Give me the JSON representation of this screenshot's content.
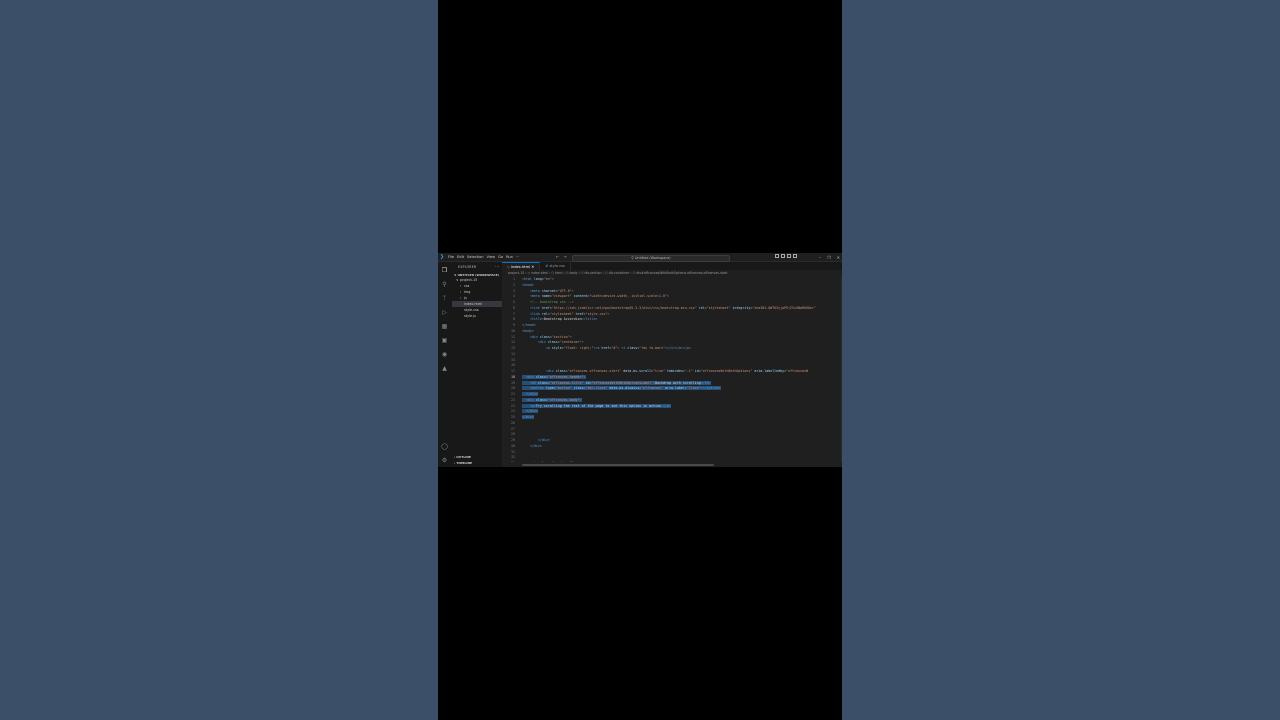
{
  "titlebar": {
    "menu": [
      "File",
      "Edit",
      "Selection",
      "View",
      "Go",
      "Run",
      "···"
    ],
    "search": "Untitled (Workspace)"
  },
  "sidebar": {
    "title": "EXPLORER",
    "workspace": "UNTITLED (WORKSPACE)",
    "tree": [
      {
        "label": "project-15",
        "indent": 1,
        "chevron": "∨"
      },
      {
        "label": "css",
        "indent": 2,
        "chevron": "›"
      },
      {
        "label": "img",
        "indent": 2,
        "chevron": "›"
      },
      {
        "label": "js",
        "indent": 2,
        "chevron": "›"
      },
      {
        "label": "index.html",
        "indent": 2,
        "chevron": "",
        "selected": true
      },
      {
        "label": "style.css",
        "indent": 2,
        "chevron": ""
      },
      {
        "label": "style.js",
        "indent": 2,
        "chevron": ""
      }
    ],
    "outline": "OUTLINE",
    "timeline": "TIMELINE"
  },
  "editor": {
    "tabs": [
      {
        "label": "index.html",
        "active": true
      },
      {
        "label": "style.css",
        "active": false
      }
    ],
    "breadcrumb": "project-15 › ◇ index.html › ⬡ html › ⬡ body › ⬡ div.section › ⬡ div.container › ⬡ div#offcanvasWithBothOptions.offcanvas.offcanvas-start",
    "lines": [
      {
        "n": "1",
        "parts": [
          [
            "tag",
            "<html "
          ],
          [
            "attr",
            "lang="
          ],
          [
            "str",
            "\"en\""
          ],
          [
            "tag",
            ">"
          ]
        ]
      },
      {
        "n": "2",
        "parts": [
          [
            "tag",
            "<head>"
          ]
        ]
      },
      {
        "n": "3",
        "parts": [
          [
            "plain",
            "    "
          ],
          [
            "tag",
            "<meta "
          ],
          [
            "attr",
            "charset="
          ],
          [
            "str",
            "\"UTF-8\""
          ],
          [
            "tag",
            ">"
          ]
        ]
      },
      {
        "n": "4",
        "parts": [
          [
            "plain",
            "    "
          ],
          [
            "tag",
            "<meta "
          ],
          [
            "attr",
            "name="
          ],
          [
            "str",
            "\"viewport\" "
          ],
          [
            "attr",
            "content="
          ],
          [
            "str",
            "\"width=device-width, initial-scale=1.0\""
          ],
          [
            "tag",
            ">"
          ]
        ]
      },
      {
        "n": "5",
        "parts": [
          [
            "plain",
            "    "
          ],
          [
            "com",
            "<!-- bootstrap css -->"
          ]
        ]
      },
      {
        "n": "6",
        "parts": [
          [
            "plain",
            "    "
          ],
          [
            "tag",
            "<link "
          ],
          [
            "attr",
            "href="
          ],
          [
            "str",
            "\"https://cdn.jsdelivr.net/npm/bootstrap@5.3.3/dist/css/bootstrap.min.css\" "
          ],
          [
            "attr",
            "rel="
          ],
          [
            "str",
            "\"stylesheet\" "
          ],
          [
            "attr",
            "integrity="
          ],
          [
            "str",
            "\"sha384-QWTKZyjpPEjISv5WaRU9Oer\""
          ]
        ]
      },
      {
        "n": "7",
        "parts": [
          [
            "plain",
            "    "
          ],
          [
            "tag",
            "<link "
          ],
          [
            "attr",
            "rel="
          ],
          [
            "str",
            "\"stylesheet\" "
          ],
          [
            "attr",
            "href="
          ],
          [
            "str",
            "\"style.css\""
          ],
          [
            "tag",
            ">"
          ]
        ]
      },
      {
        "n": "8",
        "parts": [
          [
            "plain",
            "    "
          ],
          [
            "tag",
            "<title>"
          ],
          [
            "plain",
            "Bootstrap Accordion"
          ],
          [
            "tag",
            "</title>"
          ]
        ]
      },
      {
        "n": "9",
        "parts": [
          [
            "tag",
            "</head>"
          ]
        ]
      },
      {
        "n": "10",
        "parts": [
          [
            "tag",
            "<body>"
          ]
        ]
      },
      {
        "n": "11",
        "parts": [
          [
            "plain",
            "    "
          ],
          [
            "tag",
            "<div "
          ],
          [
            "attr",
            "class="
          ],
          [
            "str",
            "\"section\""
          ],
          [
            "tag",
            ">"
          ]
        ]
      },
      {
        "n": "12",
        "parts": [
          [
            "plain",
            "        "
          ],
          [
            "tag",
            "<div "
          ],
          [
            "attr",
            "class="
          ],
          [
            "str",
            "\"container\""
          ],
          [
            "tag",
            ">"
          ]
        ]
      },
      {
        "n": "13",
        "parts": [
          [
            "plain",
            "            "
          ],
          [
            "tag",
            "<p "
          ],
          [
            "attr",
            "style="
          ],
          [
            "str",
            "\"float: right;\""
          ],
          [
            "tag",
            "><a "
          ],
          [
            "attr",
            "href="
          ],
          [
            "str",
            "\"#\""
          ],
          [
            "tag",
            "> <i "
          ],
          [
            "attr",
            "class="
          ],
          [
            "str",
            "\"fas fa-bars\""
          ],
          [
            "tag",
            "></i></a></p>"
          ]
        ]
      },
      {
        "n": "14",
        "parts": []
      },
      {
        "n": "15",
        "parts": []
      },
      {
        "n": "16",
        "parts": []
      },
      {
        "n": "17",
        "parts": [
          [
            "plain",
            "            "
          ],
          [
            "tag",
            "<div "
          ],
          [
            "attr",
            "class="
          ],
          [
            "str",
            "\"offcanvas offcanvas-start\" "
          ],
          [
            "attr",
            "data-bs-scroll="
          ],
          [
            "str",
            "\"true\" "
          ],
          [
            "attr",
            "tabindex="
          ],
          [
            "str",
            "\"-1\" "
          ],
          [
            "attr",
            "id="
          ],
          [
            "str",
            "\"offcanvasWithBothOptions\" "
          ],
          [
            "attr",
            "aria-labelledby="
          ],
          [
            "str",
            "\"offcanvasW"
          ]
        ]
      },
      {
        "n": "18",
        "cur": true,
        "hl": true,
        "parts": [
          [
            "plain",
            "  "
          ],
          [
            "tag",
            "<div "
          ],
          [
            "attr",
            "class="
          ],
          [
            "str",
            "\"offcanvas-header\""
          ],
          [
            "tag",
            ">"
          ]
        ]
      },
      {
        "n": "19",
        "hl": true,
        "parts": [
          [
            "plain",
            "    "
          ],
          [
            "tag",
            "<h5 "
          ],
          [
            "attr",
            "class="
          ],
          [
            "str",
            "\"offcanvas-title\" "
          ],
          [
            "attr",
            "id="
          ],
          [
            "str",
            "\"offcanvasWithBothOptionsLabel\""
          ],
          [
            "tag",
            ">"
          ],
          [
            "plain",
            "Backdrop with scrolling"
          ],
          [
            "tag",
            "</h5>"
          ]
        ]
      },
      {
        "n": "20",
        "hl": true,
        "parts": [
          [
            "plain",
            "    "
          ],
          [
            "tag",
            "<button "
          ],
          [
            "attr",
            "type="
          ],
          [
            "str",
            "\"button\" "
          ],
          [
            "attr",
            "class="
          ],
          [
            "str",
            "\"btn-close\" "
          ],
          [
            "attr",
            "data-bs-dismiss="
          ],
          [
            "str",
            "\"offcanvas\" "
          ],
          [
            "attr",
            "aria-label="
          ],
          [
            "str",
            "\"Close\""
          ],
          [
            "tag",
            "></button>"
          ]
        ]
      },
      {
        "n": "21",
        "hl": true,
        "parts": [
          [
            "plain",
            "  "
          ],
          [
            "tag",
            "</div>"
          ]
        ]
      },
      {
        "n": "22",
        "hl": true,
        "parts": [
          [
            "plain",
            "  "
          ],
          [
            "tag",
            "<div "
          ],
          [
            "attr",
            "class="
          ],
          [
            "str",
            "\"offcanvas-body\""
          ],
          [
            "tag",
            ">"
          ]
        ]
      },
      {
        "n": "23",
        "hl": true,
        "parts": [
          [
            "plain",
            "    "
          ],
          [
            "tag",
            "<p>"
          ],
          [
            "plain",
            "Try scrolling the rest of the page to see this option in action."
          ],
          [
            "tag",
            "</p>"
          ]
        ]
      },
      {
        "n": "24",
        "hl": true,
        "parts": [
          [
            "plain",
            "  "
          ],
          [
            "tag",
            "</div>"
          ]
        ]
      },
      {
        "n": "25",
        "hl": true,
        "parts": [
          [
            "tag",
            "</div>"
          ]
        ]
      },
      {
        "n": "26",
        "parts": []
      },
      {
        "n": "27",
        "parts": []
      },
      {
        "n": "28",
        "parts": []
      },
      {
        "n": "29",
        "parts": [
          [
            "plain",
            "        "
          ],
          [
            "tag",
            "</div>"
          ]
        ]
      },
      {
        "n": "30",
        "parts": [
          [
            "plain",
            "    "
          ],
          [
            "tag",
            "</div>"
          ]
        ]
      },
      {
        "n": "31",
        "parts": []
      },
      {
        "n": "32",
        "parts": []
      },
      {
        "n": "33",
        "parts": [
          [
            "plain",
            "    "
          ],
          [
            "tag",
            "<div "
          ],
          [
            "attr",
            "class="
          ],
          [
            "str",
            "\"section-2\""
          ],
          [
            "tag",
            ">"
          ]
        ]
      },
      {
        "n": "34",
        "parts": [
          [
            "plain",
            "        "
          ],
          [
            "tag",
            "<div "
          ],
          [
            "attr",
            "class="
          ],
          [
            "str",
            "\"container\""
          ],
          [
            "tag",
            ">"
          ]
        ]
      }
    ]
  },
  "colors": {
    "page_background": "#3b5068",
    "editor_background": "#1f1f1f",
    "selection": "#264f78",
    "accent": "#0078d4"
  }
}
